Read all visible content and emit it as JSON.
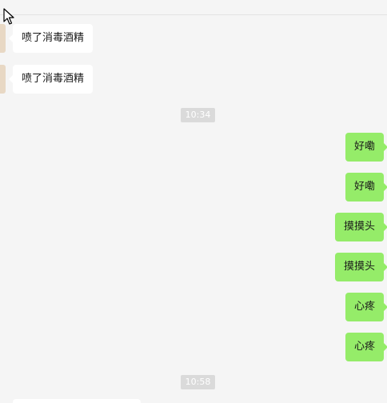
{
  "messages": [
    {
      "direction": "incoming",
      "text": "喷了消毒酒精"
    },
    {
      "direction": "incoming",
      "text": "喷了消毒酒精"
    },
    {
      "timestamp": "10:34"
    },
    {
      "direction": "outgoing",
      "text": "好嘞"
    },
    {
      "direction": "outgoing",
      "text": "好嘞"
    },
    {
      "direction": "outgoing",
      "text": "摸摸头"
    },
    {
      "direction": "outgoing",
      "text": "摸摸头"
    },
    {
      "direction": "outgoing",
      "text": "心疼"
    },
    {
      "direction": "outgoing",
      "text": "心疼"
    },
    {
      "timestamp": "10:58"
    }
  ],
  "colors": {
    "background": "#f5f5f5",
    "incoming_bubble": "#ffffff",
    "outgoing_bubble": "#95ec69",
    "timestamp_chip": "#dadada"
  },
  "icons": [
    "mouse-cursor-icon"
  ]
}
